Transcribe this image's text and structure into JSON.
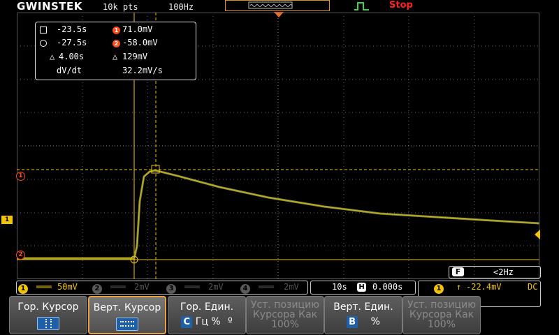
{
  "header": {
    "brand": "GWINSTEK",
    "record_length": "10k pts",
    "sample_rate": "100Hz",
    "run_state": "Stop"
  },
  "colors": {
    "ch1": "#f2c300",
    "cursor_marker": "#ff4a1a",
    "stop": "#ff2020",
    "selected_border": "#e8a040",
    "grid": "#6a6a6a"
  },
  "cursor_readout": {
    "h1_time": "-23.5s",
    "h2_time": "-27.5s",
    "delta_time": "4.00s",
    "v1_value": "71.0mV",
    "v2_value": "-58.0mV",
    "delta_value": "129mV",
    "dvdt_label": "dV/dt",
    "dvdt_value": "32.2mV/s",
    "v1_marker": "1",
    "v2_marker": "2"
  },
  "side_markers": {
    "cursor1": "1",
    "cursor2": "2",
    "channel1": "1"
  },
  "filter": {
    "badge": "F",
    "value": "<2Hz"
  },
  "status_bar": {
    "ch1": {
      "num": "1",
      "scale": "50mV"
    },
    "ch2": {
      "num": "2",
      "scale": "2mV"
    },
    "ch3": {
      "num": "3",
      "scale": "2mV"
    },
    "ch4": {
      "num": "4",
      "scale": "2mV"
    },
    "timebase": "10s",
    "horiz_badge": "H",
    "position": "0.000s",
    "trig_source": "1",
    "trig_level": "-22.4mV",
    "coupling": "DC"
  },
  "softkeys": {
    "h_cursor": "Гор. Курсор",
    "v_cursor": "Верт. Курсор",
    "h_unit": "Гор. Един.",
    "h_unit_c": "C",
    "h_unit_options": "Гц %",
    "h_unit_deg": "º",
    "set_pos": "Уст. позицию Курсора Как 100%",
    "v_unit": "Верт. Един.",
    "v_unit_b": "B",
    "v_unit_pct": "%",
    "set_pos2": "Уст. позицию Курсора Как 100%"
  }
}
